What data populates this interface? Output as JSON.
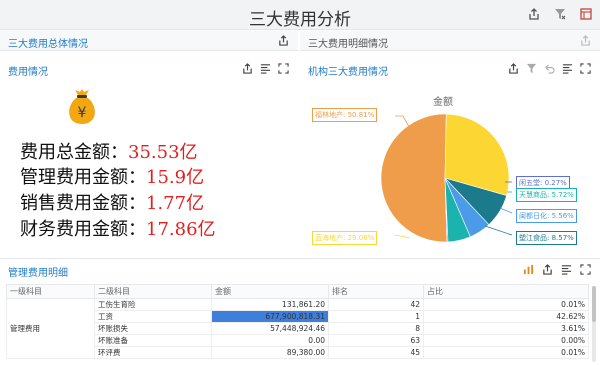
{
  "app_title": "三大费用分析",
  "tabs": {
    "left": "三大费用总体情况",
    "right": "三大费用明细情况"
  },
  "panels": {
    "cost_overview": "费用情况",
    "org_costs": "机构三大费用情况"
  },
  "kpis": [
    {
      "label": "费用总金额：",
      "value": "35.53亿"
    },
    {
      "label": "管理费用金额：",
      "value": "15.9亿"
    },
    {
      "label": "销售费用金额：",
      "value": "1.77亿"
    },
    {
      "label": "财务费用金额：",
      "value": "17.86亿"
    }
  ],
  "money_bag_symbol": "¥",
  "chart_data": {
    "type": "pie",
    "title": "金额",
    "categories": [
      "福林地产",
      "闲五堂",
      "天慧商品",
      "闽都日化",
      "塑江食品",
      "蓝海地产"
    ],
    "labels": [
      "福林地产: 50.81%",
      "闲五堂: 0.27%",
      "天慧商品: 5.72%",
      "闽都日化: 5.56%",
      "塑江食品: 8.57%",
      "蓝海地产: 29.08%"
    ],
    "values": [
      50.81,
      0.27,
      5.72,
      5.56,
      8.57,
      29.08
    ],
    "colors": [
      "#ef9d4b",
      "#5b6fd6",
      "#1bb3ad",
      "#4c9be8",
      "#1b7a8c",
      "#fcd733"
    ]
  },
  "detail": {
    "title": "管理费用明细",
    "columns": [
      "一级科目",
      "二级科目",
      "金额",
      "排名",
      "占比"
    ],
    "group": "管理费用",
    "rows": [
      {
        "name": "工伤生育险",
        "amount": "131,861.20",
        "rank": "42",
        "pct": "0.01%",
        "highlight": false
      },
      {
        "name": "工资",
        "amount": "677,900,818.31",
        "rank": "1",
        "pct": "42.62%",
        "highlight": true
      },
      {
        "name": "坏账损失",
        "amount": "57,448,924.46",
        "rank": "8",
        "pct": "3.61%",
        "highlight": false
      },
      {
        "name": "坏账准备",
        "amount": "0.00",
        "rank": "63",
        "pct": "0.00%",
        "highlight": false
      },
      {
        "name": "环评费",
        "amount": "89,380.00",
        "rank": "45",
        "pct": "0.01%",
        "highlight": false
      }
    ]
  },
  "icons": [
    "share-icon",
    "filter-clear-icon",
    "dashboard-icon",
    "data-icon",
    "fullscreen-icon",
    "undo-icon",
    "grid-icon"
  ],
  "colors": {
    "accent": "#1f7cc8",
    "kpi_value": "#e02020",
    "highlight_cell": "#3f7fdc"
  }
}
